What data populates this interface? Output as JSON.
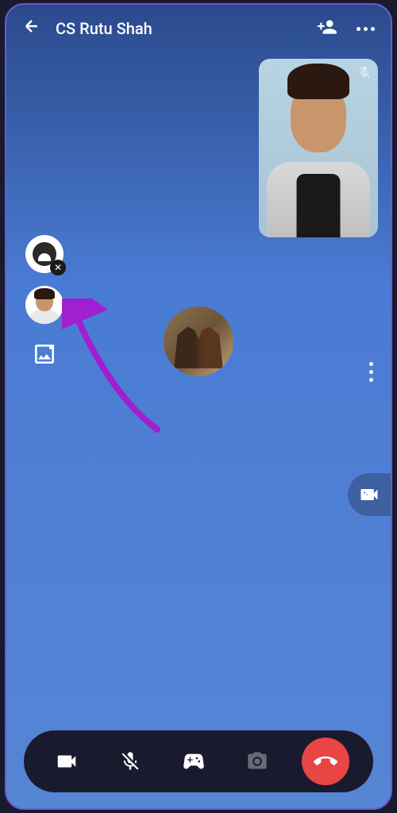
{
  "header": {
    "contact_name": "CS Rutu Shah"
  },
  "icons": {
    "back": "back-arrow",
    "add_person": "add-person",
    "more": "more-horizontal",
    "mute": "mic-muted",
    "sticker": "sticker-face",
    "close": "close-x",
    "avatar_option": "avatar-figure",
    "gallery": "gallery-sparkle",
    "side_more": "more-vertical",
    "effects": "video-effects",
    "video": "video-camera",
    "mic_off": "mic-muted-slash",
    "games": "game-controller",
    "camera": "camera",
    "end_call": "phone-hangup"
  },
  "colors": {
    "accent_arrow": "#a020d0",
    "end_call": "#e84545",
    "gradient_top": "#2b4a8c",
    "gradient_bottom": "#5586d5"
  }
}
